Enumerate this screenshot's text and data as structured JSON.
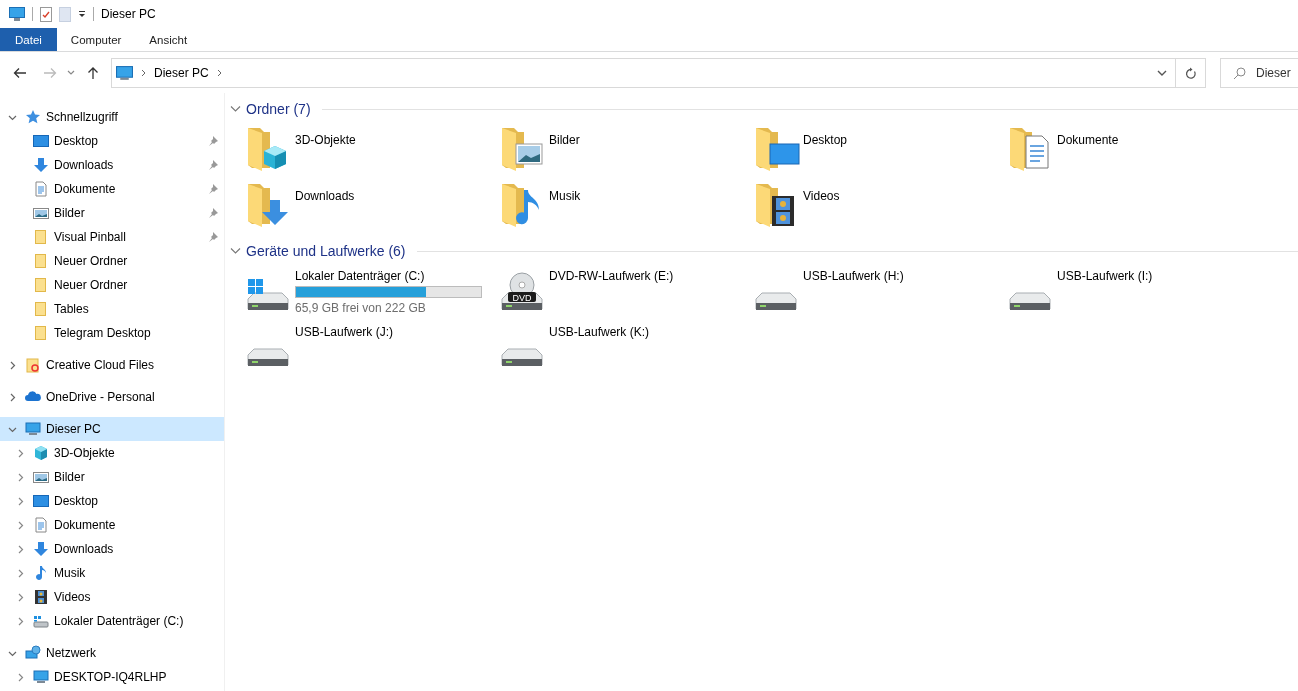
{
  "window": {
    "title": "Dieser PC"
  },
  "ribbon": {
    "tabs": [
      {
        "label": "Datei",
        "selected": true
      },
      {
        "label": "Computer",
        "selected": false
      },
      {
        "label": "Ansicht",
        "selected": false
      }
    ]
  },
  "address_bar": {
    "path": [
      "Dieser PC"
    ]
  },
  "search": {
    "placeholder": "Dieser"
  },
  "navigation": {
    "items": [
      {
        "label": "Schnellzugriff",
        "kind": "quickaccess",
        "expanded": true,
        "selected": false,
        "children": [
          {
            "label": "Desktop",
            "kind": "desktop",
            "pinned": true,
            "selected": false
          },
          {
            "label": "Downloads",
            "kind": "downloads",
            "pinned": true,
            "selected": false
          },
          {
            "label": "Dokumente",
            "kind": "documents",
            "pinned": true,
            "selected": false
          },
          {
            "label": "Bilder",
            "kind": "pictures",
            "pinned": true,
            "selected": false
          },
          {
            "label": "Visual Pinball",
            "kind": "folder",
            "pinned": true,
            "selected": false
          },
          {
            "label": "Neuer Ordner",
            "kind": "folder",
            "pinned": false,
            "selected": false
          },
          {
            "label": "Neuer Ordner",
            "kind": "folder",
            "pinned": false,
            "selected": false
          },
          {
            "label": "Tables",
            "kind": "folder",
            "pinned": false,
            "selected": false
          },
          {
            "label": "Telegram Desktop",
            "kind": "folder",
            "pinned": false,
            "selected": false
          }
        ]
      },
      {
        "label": "Creative Cloud Files",
        "kind": "cloudfolder",
        "expanded": false,
        "selected": false
      },
      {
        "label": "OneDrive - Personal",
        "kind": "onedrive",
        "expanded": false,
        "selected": false
      },
      {
        "label": "Dieser PC",
        "kind": "pc",
        "expanded": true,
        "selected": true,
        "children": [
          {
            "label": "3D-Objekte",
            "kind": "objects3d",
            "expanded": false,
            "selected": false
          },
          {
            "label": "Bilder",
            "kind": "pictures",
            "expanded": false,
            "selected": false
          },
          {
            "label": "Desktop",
            "kind": "desktop",
            "expanded": false,
            "selected": false
          },
          {
            "label": "Dokumente",
            "kind": "documents",
            "expanded": false,
            "selected": false
          },
          {
            "label": "Downloads",
            "kind": "downloads",
            "expanded": false,
            "selected": false
          },
          {
            "label": "Musik",
            "kind": "music",
            "expanded": false,
            "selected": false
          },
          {
            "label": "Videos",
            "kind": "videos",
            "expanded": false,
            "selected": false
          },
          {
            "label": "Lokaler Datenträger (C:)",
            "kind": "drive",
            "expanded": false,
            "selected": false
          }
        ]
      },
      {
        "label": "Netzwerk",
        "kind": "network",
        "expanded": true,
        "selected": false,
        "children": [
          {
            "label": "DESKTOP-IQ4RLHP",
            "kind": "pc",
            "expanded": false,
            "selected": false
          }
        ]
      }
    ]
  },
  "sections": [
    {
      "title": "Ordner (7)",
      "expanded": true,
      "items": [
        {
          "label": "3D-Objekte",
          "kind": "objects3d"
        },
        {
          "label": "Bilder",
          "kind": "pictures"
        },
        {
          "label": "Desktop",
          "kind": "desktop"
        },
        {
          "label": "Dokumente",
          "kind": "documents"
        },
        {
          "label": "Downloads",
          "kind": "downloads"
        },
        {
          "label": "Musik",
          "kind": "music"
        },
        {
          "label": "Videos",
          "kind": "videos"
        }
      ]
    },
    {
      "title": "Geräte und Laufwerke (6)",
      "expanded": true,
      "items": [
        {
          "label": "Lokaler Datenträger (C:)",
          "kind": "system_drive",
          "level": 0.7,
          "detail": "65,9 GB frei von 222 GB"
        },
        {
          "label": "DVD-RW-Laufwerk (E:)",
          "kind": "dvd",
          "badge": "DVD"
        },
        {
          "label": "USB-Laufwerk (H:)",
          "kind": "usb"
        },
        {
          "label": "USB-Laufwerk (I:)",
          "kind": "usb"
        },
        {
          "label": "USB-Laufwerk (J:)",
          "kind": "usb"
        },
        {
          "label": "USB-Laufwerk (K:)",
          "kind": "usb"
        }
      ]
    }
  ]
}
